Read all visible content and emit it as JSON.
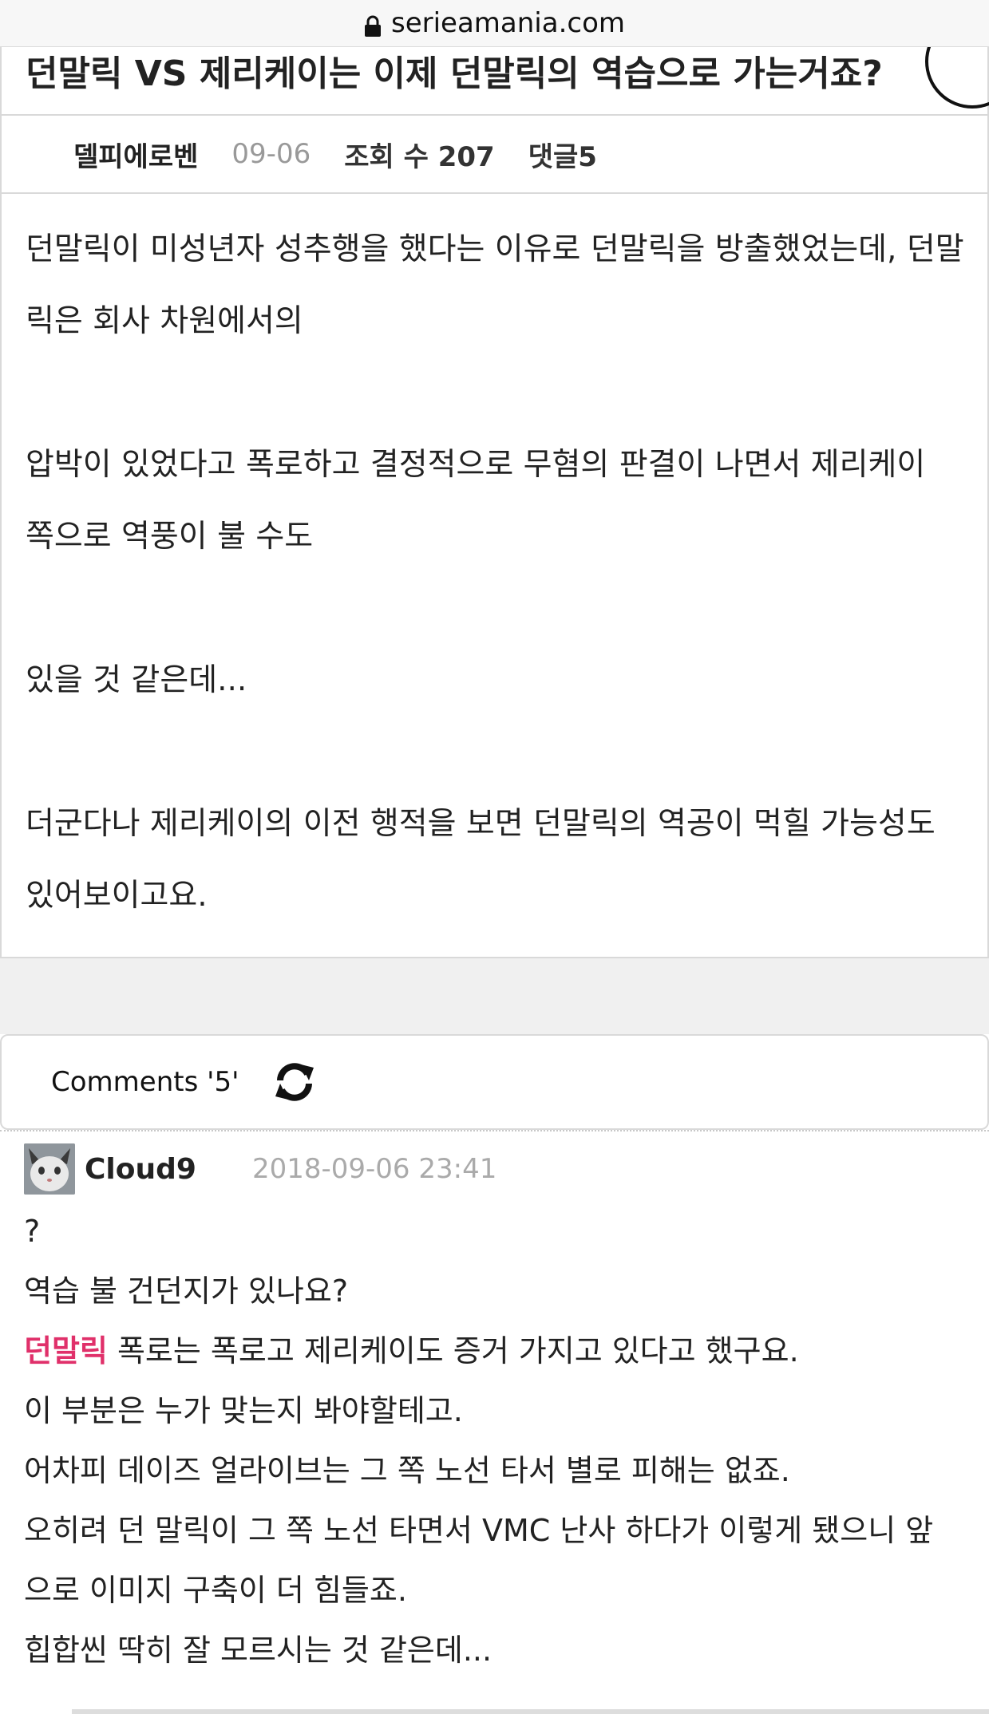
{
  "browser": {
    "url": "serieamania.com",
    "lock_icon": "lock-icon"
  },
  "post": {
    "title": "던말릭 VS 제리케이는 이제 던말릭의 역습으로 가는거죠?",
    "author": "델피에로벤",
    "date": "09-06",
    "views": "조회 수 207",
    "comments": "댓글5",
    "body": {
      "p1_line1": "던말릭이 미성년자 성추행을 했다는 이유로 던말릭을 방출했었는데, 던말",
      "p1_line2": "릭은 회사 차원에서의",
      "p2_line1": "압박이 있었다고 폭로하고 결정적으로 무혐의 판결이 나면서 제리케이",
      "p2_line2": "쪽으로 역풍이 불 수도",
      "p3_line1": "있을 것 같은데...",
      "p4_line1": "더군다나 제리케이의 이전 행적을 보면 던말릭의 역공이 먹힐 가능성도",
      "p4_line2": "있어보이고요."
    }
  },
  "comments_section": {
    "label": "Comments '5'",
    "refresh_icon": "refresh-icon"
  },
  "comment": {
    "author": "Cloud9",
    "timestamp": "2018-09-06 23:41",
    "avatar": "cat-avatar",
    "lines": {
      "l1": "?",
      "l2": "역습 불 건던지가 있나요?",
      "l3_highlight": "던말릭",
      "l3_rest": " 폭로는 폭로고 제리케이도 증거 가지고 있다고 했구요.",
      "l4": "이 부분은 누가 맞는지 봐야할테고.",
      "l5": "어차피 데이즈 얼라이브는 그 쪽 노선 타서 별로 피해는 없죠.",
      "l6": "오히려 던 말릭이 그 쪽 노선 타면서 VMC 난사 하다가 이렇게 됐으니 앞",
      "l7": "으로 이미지 구축이 더 힘들죠.",
      "l8": "힙합씬 딱히 잘 모르시는 것 같은데..."
    }
  },
  "colors": {
    "highlight": "#e0306a",
    "date_gray": "#999999",
    "border": "#d9d9d9",
    "band": "#f0f0f0"
  }
}
